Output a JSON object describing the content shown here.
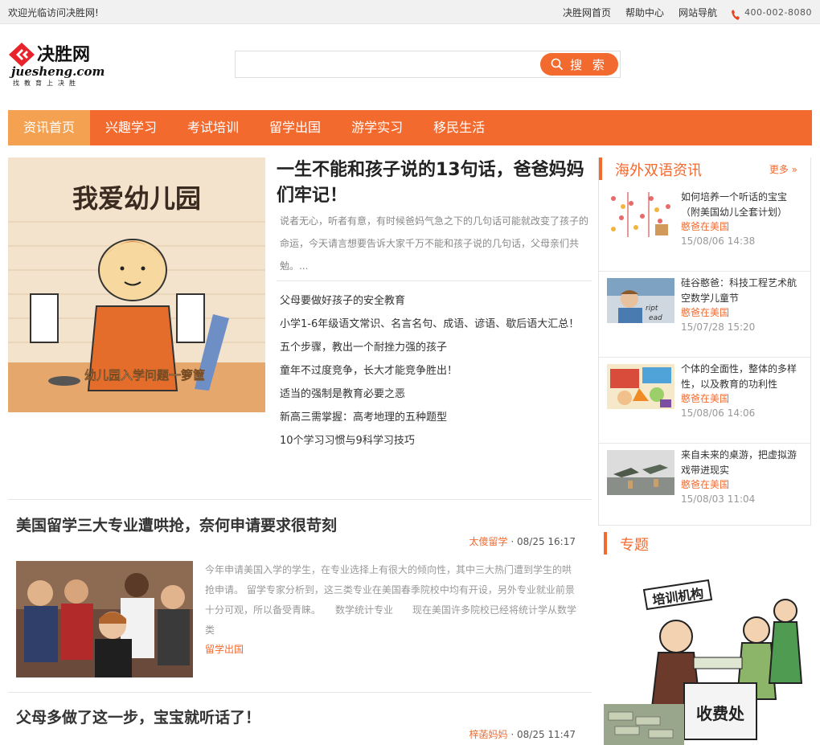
{
  "topbar": {
    "welcome": "欢迎光临访问决胜网!",
    "links": [
      "决胜网首页",
      "帮助中心",
      "网站导航"
    ],
    "phone": "400-002-8080"
  },
  "logo": {
    "brand": "决胜网",
    "domain": "juesheng.com",
    "slogan": "找教育上决胜"
  },
  "search": {
    "value": "",
    "button": "搜 索"
  },
  "nav": {
    "items": [
      "资讯首页",
      "兴趣学习",
      "考试培训",
      "留学出国",
      "游学实习",
      "移民生活"
    ],
    "active": 0
  },
  "featured": {
    "image_caption": "幼儿园入学问题一箩筐",
    "image_text": "我爱幼儿园",
    "title": "一生不能和孩子说的13句话，爸爸妈妈们牢记！",
    "summary": "说者无心，听者有意，有时候爸妈气急之下的几句话可能就改变了孩子的命运，今天请言想要告诉大家千万不能和孩子说的几句话，父母亲们共勉。...",
    "links": [
      "父母要做好孩子的安全教育",
      "小学1-6年级语文常识、名言名句、成语、谚语、歇后语大汇总！",
      "五个步骤，教出一个耐挫力强的孩子",
      "童年不过度竞争，长大才能竞争胜出！",
      "适当的强制是教育必要之恶",
      "新高三需掌握：高考地理的五种题型",
      "10个学习习惯与9科学习技巧"
    ]
  },
  "articles": [
    {
      "title": "美国留学三大专业遭哄抢，奈何申请要求很苛刻",
      "author": "太傻留学",
      "date": "· 08/25 16:17",
      "excerpt": "今年申请美国入学的学生，在专业选择上有很大的倾向性，其中三大热门遭到学生的哄抢申请。 留学专家分析到，这三类专业在美国春季院校中均有开设，另外专业就业前景十分可观，所以备受青睐。　　数学统计专业　　现在美国许多院校已经将统计学从数学类",
      "tag": "留学出国"
    },
    {
      "title": "父母多做了这一步，宝宝就听话了！",
      "author": "梓菡妈妈",
      "date": "· 08/25 11:47"
    }
  ],
  "sidebar": {
    "title": "海外双语资讯",
    "more": "更多",
    "items": [
      {
        "title": "如何培养一个听话的宝宝（附美国幼儿全套计划）",
        "source": "憨爸在美国",
        "time": "15/08/06 14:38"
      },
      {
        "title": "硅谷憨爸：科技工程艺术航空数学儿童节",
        "source": "憨爸在美国",
        "time": "15/07/28 15:20"
      },
      {
        "title": "个体的全面性，整体的多样性，以及教育的功利性",
        "source": "憨爸在美国",
        "time": "15/08/06 14:06"
      },
      {
        "title": "来自未来的桌游，把虚拟游戏带进现实",
        "source": "憨爸在美国",
        "time": "15/08/03 11:04"
      }
    ]
  },
  "topic": {
    "title": "专题",
    "banner_text": "培训机构",
    "desk_text": "收费处"
  },
  "colors": {
    "accent": "#f26a2e",
    "nav_active": "#f4a251"
  }
}
